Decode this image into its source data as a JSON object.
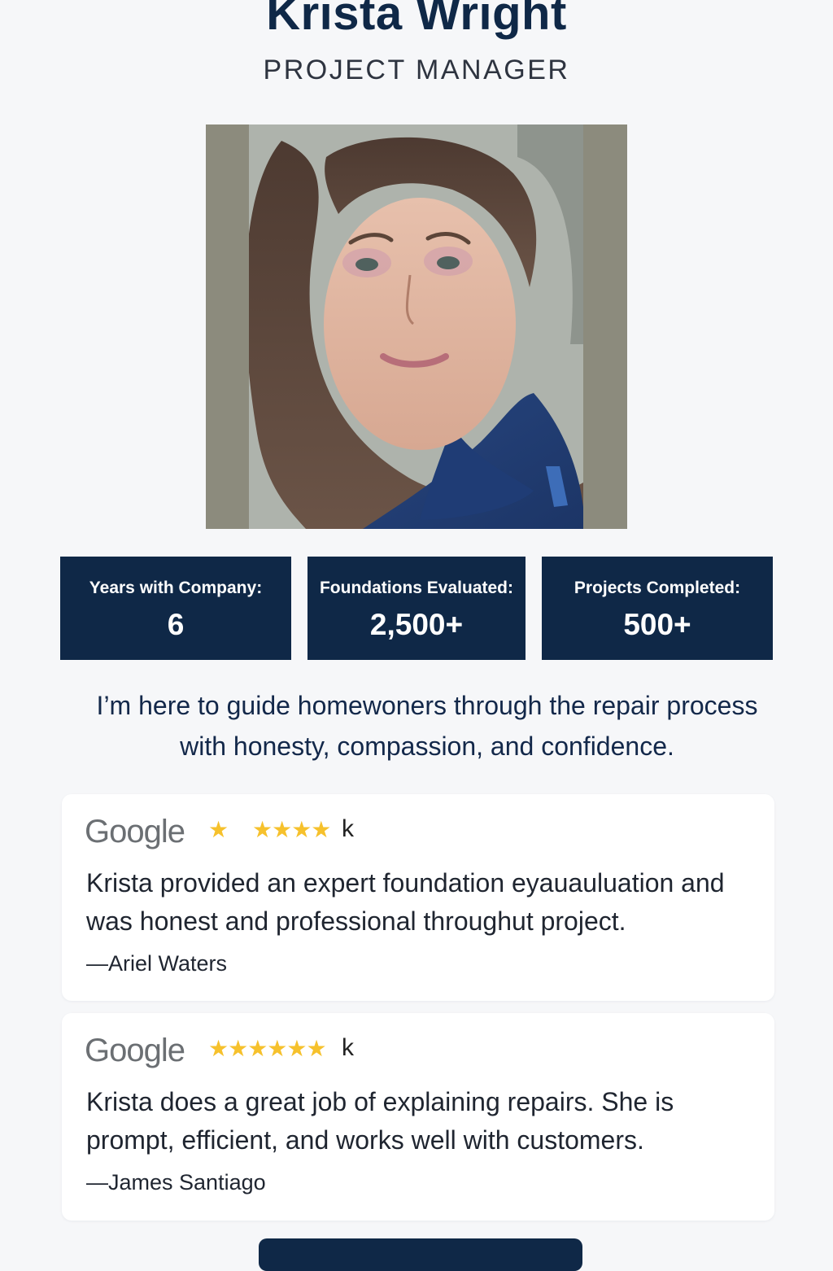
{
  "profile": {
    "name": "Krista Wright",
    "role": "PROJECT MANAGER"
  },
  "stats": [
    {
      "label": "Years with Company:",
      "value": "6"
    },
    {
      "label": "Foundations Evaluated:",
      "value": "2,500+"
    },
    {
      "label": "Projects Completed:",
      "value": "500+"
    }
  ],
  "mission": "I’m here to guide homewoners through the repair process with honesty, compassion, and confidence.",
  "reviews": [
    {
      "source": "Google",
      "stars_a": "★",
      "stars_b": "★★★★",
      "suffix": "k",
      "text": "Krista provided an expert  foundation eyauauluation and was honest and professional throughut project.",
      "author": "—Ariel Waters"
    },
    {
      "source": "Google",
      "stars_a": "★★★★★★",
      "suffix": "k",
      "text": "Krista does a great job of  explaining repairs.  She is prompt, efficient, and works well with customers.",
      "author": "—James Santiago"
    }
  ],
  "colors": {
    "navy": "#0f2847",
    "star": "#f6c12c",
    "background": "#f6f7f9"
  }
}
